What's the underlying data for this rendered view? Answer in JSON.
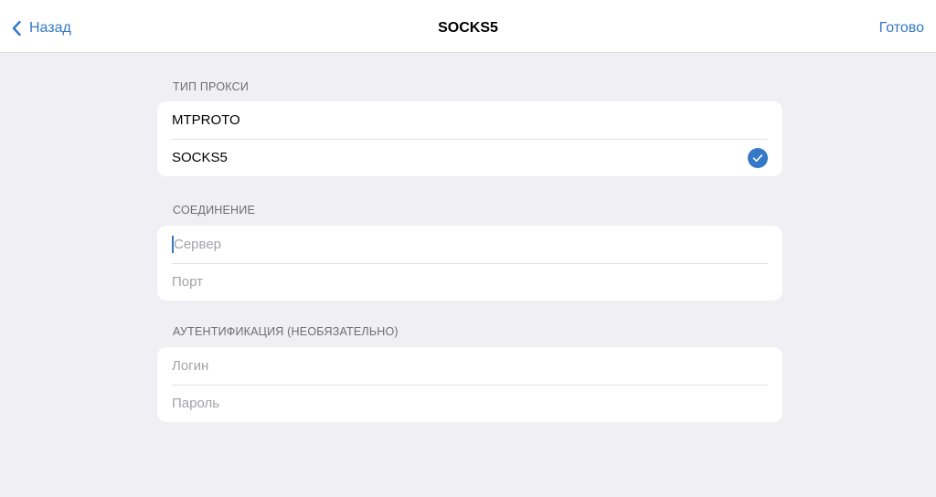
{
  "navbar": {
    "back_label": "Назад",
    "title": "SOCKS5",
    "done_label": "Готово"
  },
  "proxy_type": {
    "header": "ТИП ПРОКСИ",
    "options": [
      {
        "label": "MTPROTO",
        "selected": false
      },
      {
        "label": "SOCKS5",
        "selected": true
      }
    ]
  },
  "connection": {
    "header": "СОЕДИНЕНИЕ",
    "server": {
      "value": "",
      "placeholder": "Сервер"
    },
    "port": {
      "value": "",
      "placeholder": "Порт"
    }
  },
  "auth": {
    "header": "АУТЕНТИФИКАЦИЯ (НЕОБЯЗАТЕЛЬНО)",
    "login": {
      "value": "",
      "placeholder": "Логин"
    },
    "password": {
      "value": "",
      "placeholder": "Пароль"
    }
  },
  "colors": {
    "accent": "#3478c6",
    "background": "#efeff4",
    "placeholder": "#a3a3a8"
  },
  "icons": {
    "back": "chevron-left-icon",
    "selected": "checkmark-circle-icon"
  }
}
